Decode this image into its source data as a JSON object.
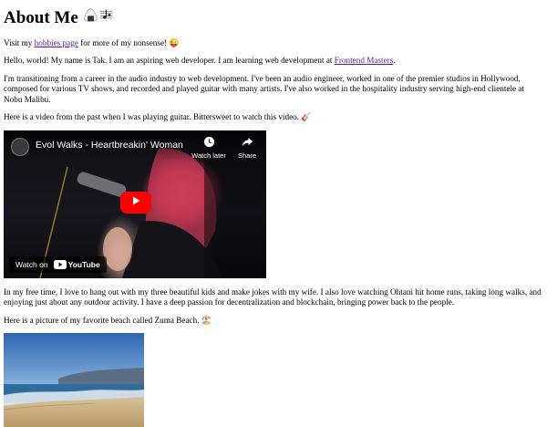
{
  "heading": {
    "title": "About Me",
    "icons": [
      "onigiri-icon",
      "music-score-icon"
    ]
  },
  "intro": {
    "prefix": "Visit my",
    "link_text": "hobbies page",
    "suffix": "for more of my nonsense!",
    "emoji": "😜"
  },
  "hello": {
    "text": "Hello, world! My name is Tak. I am an aspiring web developer. I am learning web development at",
    "link_text": "Frontend Masters",
    "end": "."
  },
  "career": {
    "text": "I'm transitioning from a career in the audio industry to web development. I've been an audio engineer, worked in one of the premier studios in Hollywood, composed for various TV shows, and recorded and played guitar with many artists. I've also worked in the hospitality industry serving high-end clientele at Nobu Malibu."
  },
  "video_intro": {
    "text": "Here is a video from the past when I was playing guitar. Bittersweet to watch this video.",
    "emoji": "🎸"
  },
  "video": {
    "title": "Evol Walks - Heartbreakin' Woman",
    "watch_later": "Watch later",
    "share": "Share",
    "watch_on": "Watch on",
    "platform": "YouTube",
    "colors": {
      "play_button": "#ff0000"
    }
  },
  "free_time": {
    "text": "In my free time, I love to hang out with my three beautiful kids and make jokes with my wife. I also love watching Ohtani hit home runs, taking long walks, and enjoying just about any outdoor activity. I have a deep passion for decentralization and blockchain, bringing power back to the people."
  },
  "beach_intro": {
    "text": "Here is a picture of my favorite beach called Zuma Beach.",
    "emoji": "🏖️"
  },
  "beach_image": {
    "subject": "Zuma Beach photo"
  }
}
